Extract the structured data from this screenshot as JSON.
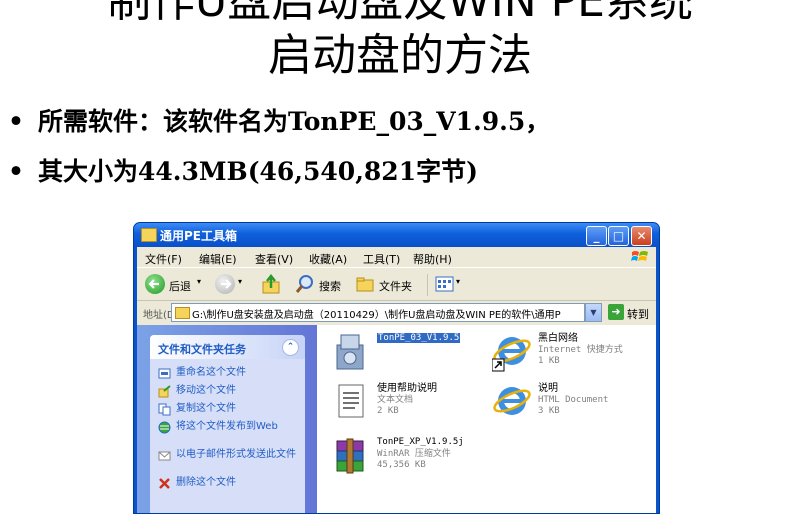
{
  "slide": {
    "title_line1": "制作U盘启动盘及WIN PE系统",
    "title_line2": "启动盘的方法",
    "bullets": [
      "所需软件：该软件名为TonPE_03_V1.9.5，",
      "其大小为44.3MB(46,540,821字节)"
    ]
  },
  "window": {
    "title": "通用PE工具箱",
    "menu": [
      "文件(F)",
      "编辑(E)",
      "查看(V)",
      "收藏(A)",
      "工具(T)",
      "帮助(H)"
    ],
    "toolbar": {
      "back": "后退",
      "search": "搜索",
      "folders": "文件夹"
    },
    "address": {
      "label": "地址(D)",
      "value": "G:\\制作U盘安装盘及启动盘（20110429）\\制作U盘启动盘及WIN PE的软件\\通用P",
      "go": "转到"
    },
    "tasks": {
      "header": "文件和文件夹任务",
      "items": [
        "重命名这个文件",
        "移动这个文件",
        "复制这个文件",
        "将这个文件发布到Web",
        "以电子邮件形式发送此文件",
        "删除这个文件"
      ]
    },
    "files": [
      {
        "name": "TonPE_03_V1.9.5",
        "type": "",
        "size": "",
        "icon": "app-setup-icon"
      },
      {
        "name": "黑白网络",
        "type": "Internet 快捷方式",
        "size": "1 KB",
        "icon": "ie-shortcut-icon"
      },
      {
        "name": "使用帮助说明",
        "type": "文本文档",
        "size": "2 KB",
        "icon": "text-document-icon"
      },
      {
        "name": "说明",
        "type": "HTML Document",
        "size": "3 KB",
        "icon": "ie-html-icon"
      },
      {
        "name": "TonPE_XP_V1.9.5j",
        "type": "WinRAR 压缩文件",
        "size": "45,356 KB",
        "icon": "winrar-archive-icon"
      }
    ]
  },
  "colors": {
    "xp_blue": "#0a53c9",
    "task_link": "#215dc6",
    "selection": "#316ac5"
  }
}
